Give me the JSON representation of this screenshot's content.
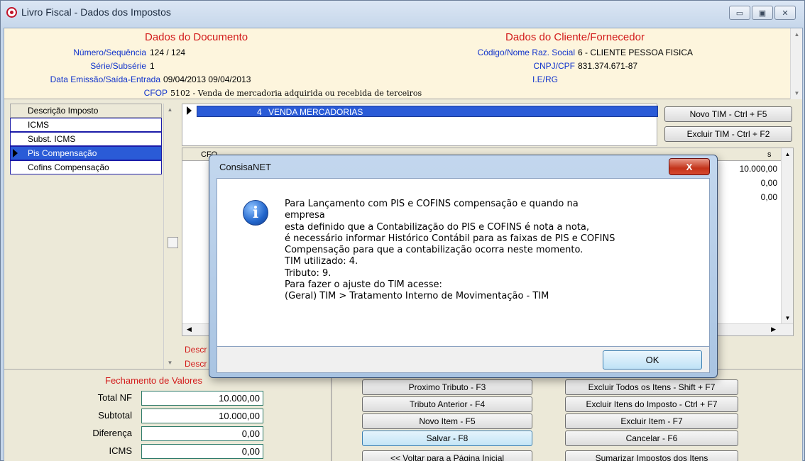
{
  "window": {
    "title": "Livro Fiscal - Dados dos Impostos",
    "min_icon": "minimize-icon",
    "max_icon": "maximize-icon",
    "close_icon": "close-icon"
  },
  "header": {
    "doc_title": "Dados do Documento",
    "client_title": "Dados do Cliente/Fornecedor",
    "numero_label": "Número/Sequência",
    "numero_value": "124 / 124",
    "serie_label": "Série/Subsérie",
    "serie_value": "1",
    "data_label": "Data Emissão/Saída-Entrada",
    "data_value": "09/04/2013 09/04/2013",
    "cfop_label": "CFOP",
    "cfop_value": "5102 - Venda de mercadoria adquirida ou recebida de terceiros",
    "codigo_label": "Código/Nome Raz. Social",
    "codigo_value": "6 - CLIENTE PESSOA FISICA",
    "cnpj_label": "CNPJ/CPF",
    "cnpj_value": "831.374.671-87",
    "ie_label": "I.E/RG"
  },
  "impostos": {
    "column_header": "Descrição Imposto",
    "items": [
      "ICMS",
      "Subst. ICMS",
      "Pis Compensação",
      "Cofins Compensação"
    ],
    "selected_index": 2
  },
  "tim": {
    "number": "4",
    "description": "VENDA MERCADORIAS"
  },
  "grid": {
    "col_first": "CFO",
    "col_last": "s",
    "values": [
      "10.000,00",
      "0,00",
      "0,00"
    ]
  },
  "desc_rows": [
    "Descr",
    "Descr"
  ],
  "buttons": {
    "novo_tim": "Novo TIM - Ctrl + F5",
    "excluir_tim": "Excluir TIM - Ctrl + F2",
    "proximo_tributo": "Proximo Tributo - F3",
    "tributo_anterior": "Tributo Anterior - F4",
    "novo_item": "Novo Item - F5",
    "salvar": "Salvar - F8",
    "voltar": "<< Voltar para a Página Inicial",
    "excluir_todos": "Excluir Todos os Itens - Shift + F7",
    "excluir_itens_imposto": "Excluir Itens do Imposto - Ctrl + F7",
    "excluir_item": "Excluir Item - F7",
    "cancelar": "Cancelar - F6",
    "sumarizar": "Sumarizar Impostos dos Itens"
  },
  "fechamento": {
    "title": "Fechamento de Valores",
    "rows": [
      {
        "label": "Total NF",
        "value": "10.000,00"
      },
      {
        "label": "Subtotal",
        "value": "10.000,00"
      },
      {
        "label": "Diferença",
        "value": "0,00"
      },
      {
        "label": "ICMS",
        "value": "0,00"
      }
    ]
  },
  "dialog": {
    "title": "ConsisaNET",
    "icon": "info-icon",
    "lines": [
      "Para Lançamento com PIS e COFINS compensação e quando na",
      "empresa",
      "esta definido que a Contabilização do PIS e COFINS é nota a nota,",
      "é necessário informar Histórico Contábil para as faixas de PIS e COFINS",
      "Compensação para que a contabilização ocorra neste momento.",
      "TIM utilizado: 4.",
      "Tributo: 9.",
      "Para fazer o ajuste do TIM acesse:",
      "(Geral) TIM > Tratamento Interno de Movimentação - TIM"
    ],
    "ok_label": "OK",
    "close_label": "X"
  }
}
